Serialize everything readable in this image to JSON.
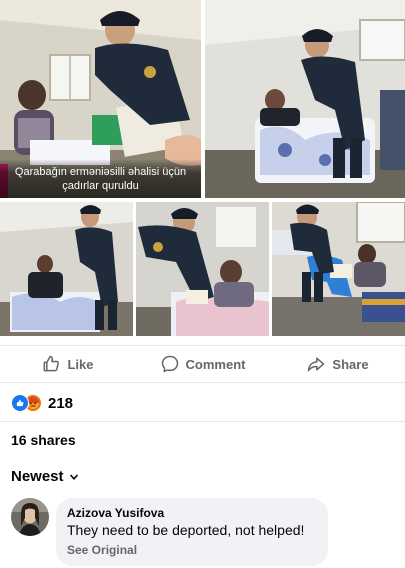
{
  "post": {
    "photo_caption_line1": "Qarabağın erməniəsilli əhalisi üçün",
    "photo_caption_line2": "çadırlar quruldu"
  },
  "actions": {
    "like_label": "Like",
    "comment_label": "Comment",
    "share_label": "Share"
  },
  "reactions": {
    "icons": [
      "like-icon",
      "angry-icon"
    ],
    "count": "218"
  },
  "shares": "16 shares",
  "comments": {
    "sort_label": "Newest",
    "items": [
      {
        "author": "Azizova Yusifova",
        "text": "They need to be deported, not helped!",
        "see_original": "See Original"
      }
    ]
  },
  "colors": {
    "facebook_blue": "#1877f2",
    "angry_orange": "#e9710f",
    "uniform_navy": "#1f2a3a",
    "bubble_gray": "#f0f2f5"
  }
}
